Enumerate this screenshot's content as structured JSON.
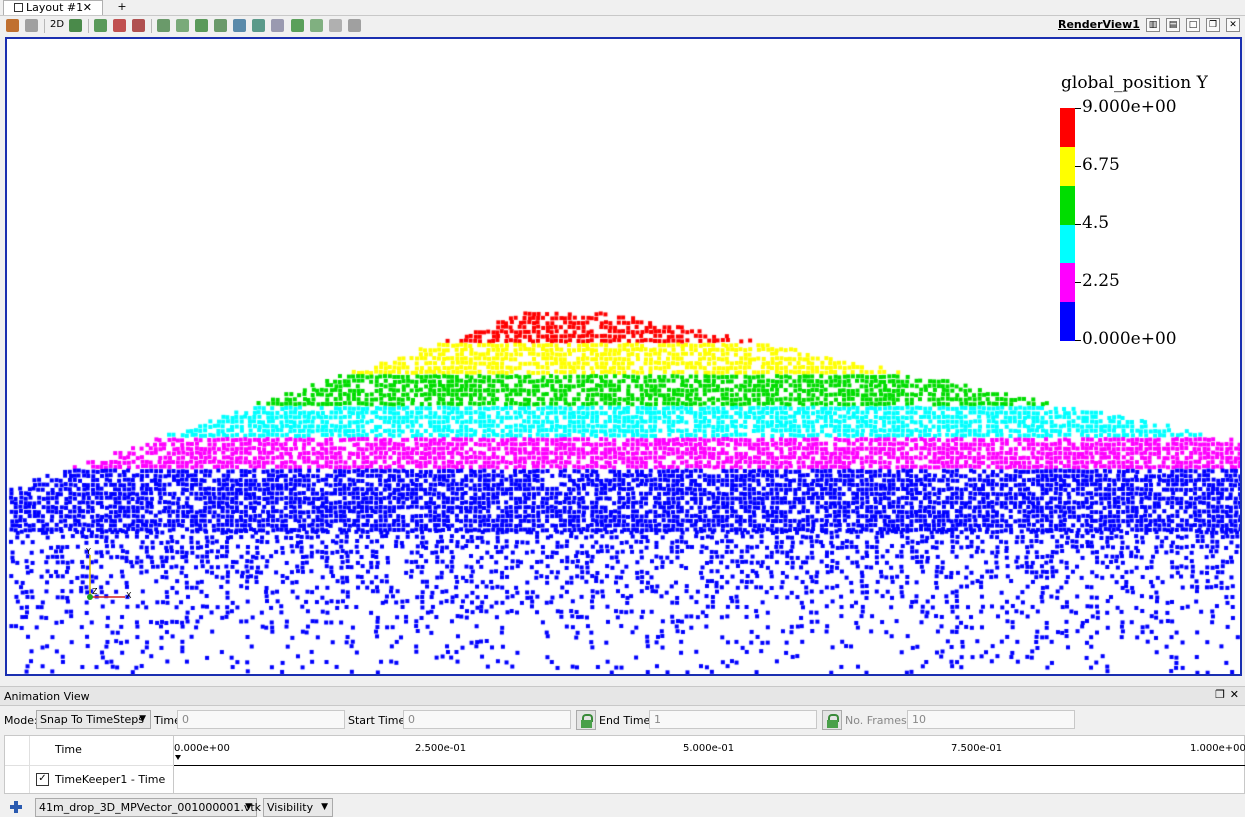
{
  "tabs": {
    "layout_label": "Layout #1",
    "close_glyph": "✕",
    "new_tab_label": "+"
  },
  "toolbar": {
    "mode_2d_label": "2D",
    "view_name": "RenderView1",
    "left_icons": [
      "reset-camera-icon",
      "zoom-to-data-icon",
      "camera-2d-icon",
      "capture-screenshot-icon",
      "select-cells-on-icon",
      "select-points-on-icon",
      "select-cells-through-icon",
      "select-points-through-icon",
      "select-cells-polygon-icon",
      "select-points-polygon-icon",
      "select-block-icon",
      "interactive-select-cells-icon",
      "interactive-select-points-icon",
      "hover-points-icon",
      "hover-cells-icon",
      "grow-selection-icon",
      "clear-selection-icon"
    ],
    "view_buttons": [
      "split-horizontal-icon",
      "split-vertical-icon",
      "maximize-icon",
      "restore-icon",
      "close-view-icon"
    ]
  },
  "legend": {
    "title": "global_position Y",
    "labels": [
      "9.000e+00",
      "6.75",
      "4.5",
      "2.25",
      "0.000e+00"
    ],
    "colors": [
      "#ff0000",
      "#ffff00",
      "#00dd00",
      "#00ffff",
      "#ff00ff",
      "#0000ff"
    ]
  },
  "point_colors": {
    "red": "#ff0000",
    "yellow": "#ffff00",
    "green": "#00dd00",
    "cyan": "#00ffff",
    "magenta": "#ff00ff",
    "blue": "#0000ff"
  },
  "animation": {
    "title": "Animation View",
    "mode_label": "Mode:",
    "mode_value": "Snap To TimeSteps",
    "time_label": "Time",
    "time_value": "0",
    "start_label": "Start Time:",
    "start_value": "0",
    "end_label": "End Time:",
    "end_value": "1",
    "frames_label": "No. Frames:",
    "frames_value": "10"
  },
  "timeline": {
    "header_label": "Time",
    "track_label": "TimeKeeper1 - Time",
    "track_checked": "✓",
    "ticks": [
      "0.000e+00",
      "2.500e-01",
      "5.000e-01",
      "7.500e-01",
      "1.000e+00"
    ]
  },
  "bottom": {
    "source_value": "41m_drop_3D_MPVector_001000001.vtk",
    "property_value": "Visibility"
  }
}
